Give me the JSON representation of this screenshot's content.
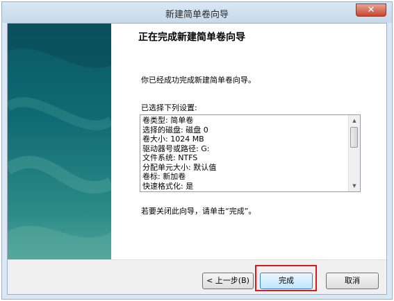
{
  "window": {
    "title": "新建简单卷向导",
    "close_glyph": "✕"
  },
  "content": {
    "heading": "正在完成新建简单卷向导",
    "description": "你已经成功完成新建简单卷向导。",
    "settings_label": "已选择下列设置:",
    "settings": [
      "卷类型: 简单卷",
      "选择的磁盘: 磁盘 0",
      "卷大小: 1024 MB",
      "驱动器号或路径: G:",
      "文件系统: NTFS",
      "分配单元大小: 默认值",
      "卷标: 新加卷",
      "快速格式化: 是"
    ],
    "close_hint": "若要关闭此向导，请单击“完成”。"
  },
  "buttons": {
    "back": "< 上一步(B)",
    "finish": "完成",
    "cancel": "取消"
  },
  "colors": {
    "highlight": "#d9171c",
    "side_panel": "#0f6b73"
  }
}
